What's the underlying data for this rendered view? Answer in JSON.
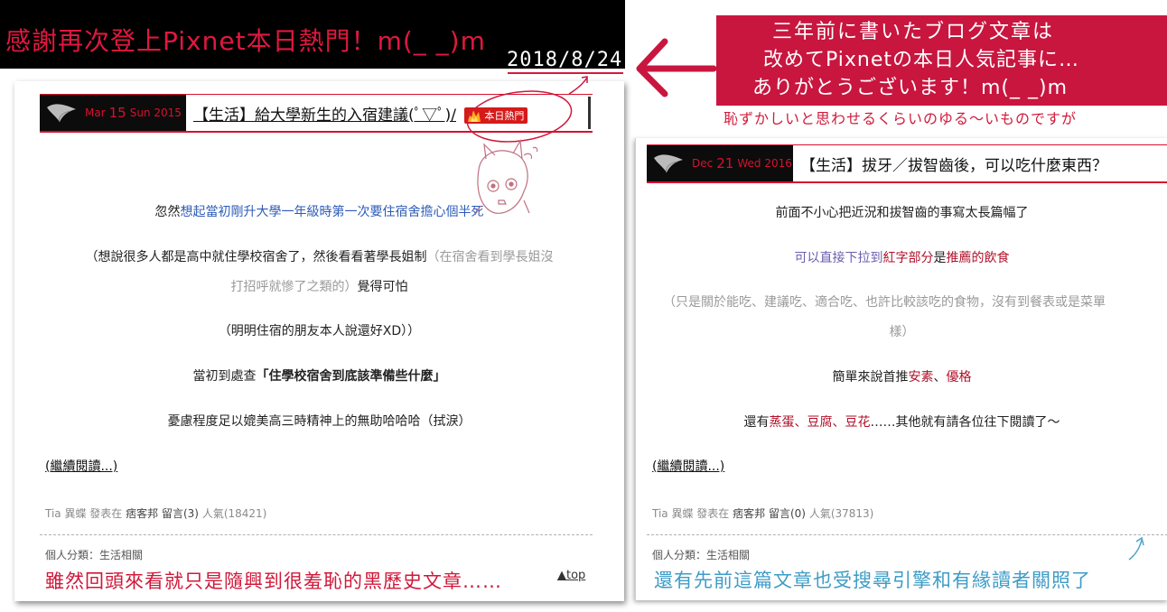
{
  "banner": {
    "title": "感謝再次登上Pixnet本日熱門！m(_ _)m",
    "date": "2018/8/24"
  },
  "note": {
    "line1": "三年前に書いたブログ文章は",
    "line2": "改めてPixnetの本日人気記事に…",
    "line3": "ありがとうございます！m(_ _)m",
    "sub": "恥ずかしいと思わせるくらいのゆる～いものですが"
  },
  "left_post": {
    "date_month": "Mar",
    "date_day": "15",
    "date_weekday": "Sun",
    "date_year": "2015",
    "title": "【生活】給大學新生的入宿建議(ﾟ▽ﾟ)/",
    "hot_badge": "本日熱門",
    "p1_plain": "忽然",
    "p1_blue": "想起當初剛升大學一年級時第一次要住宿舍擔心個半死",
    "p2_line1_plain": "（想說很多人都是高中就住學校宿舍了，然後看看著學長姐制",
    "p2_line1_grey": "（在宿舍看到學長姐沒",
    "p2_line2_grey": "打招呼就慘了之類的）",
    "p2_line2_plain": "覺得可怕",
    "p3": "（明明住宿的朋友本人說還好XD））",
    "p4_plain": "當初到處查",
    "p4_bold": "「住學校宿舍到底該準備些什麼」",
    "p5": "憂慮程度足以媲美高三時精神上的無助哈哈哈（拭淚）",
    "read_more": "(繼續閱讀...)",
    "meta_author": "Tia 異蝶",
    "meta_posted": "發表在",
    "meta_site": "痞客邦",
    "meta_comments": "留言(3)",
    "meta_views": "人氣(18421)",
    "category": "個人分類：生活相關",
    "hand_note": "雖然回頭來看就只是隨興到很羞恥的黑歷史文章……",
    "to_top": "▲top"
  },
  "right_post": {
    "date_month": "Dec",
    "date_day": "21",
    "date_weekday": "Wed",
    "date_year": "2016",
    "title": "【生活】拔牙／拔智齒後，可以吃什麼東西？",
    "p1": "前面不小心把近況和拔智齒的事寫太長篇幅了",
    "p2_purple": "可以直接下拉到",
    "p2_red": "紅字部分",
    "p2_plain": "是",
    "p2_red2": "推薦的飲食",
    "p3_line1": "（只是關於能吃、建議吃、適合吃、也許比較該吃的食物，沒有到餐表或是菜單",
    "p3_line2": "樣）",
    "p4_plain": "簡單來說首推",
    "p4_red1": "安素",
    "p4_sep": "、",
    "p4_red2": "優格",
    "p5_plain1": "還有",
    "p5_red1": "蒸蛋",
    "p5_sep1": "、",
    "p5_red2": "豆腐",
    "p5_sep2": "、",
    "p5_red3": "豆花",
    "p5_plain2": "……其他就有請各位往下閱讀了～",
    "read_more": "(繼續閱讀...)",
    "meta_author": "Tia 異蝶",
    "meta_posted": "發表在",
    "meta_site": "痞客邦",
    "meta_comments": "留言(0)",
    "meta_views": "人氣(37813)",
    "category": "個人分類：生活相關",
    "hand_note": "還有先前這篇文章也受搜尋引擎和有緣讀者關照了"
  },
  "colors": {
    "accent_red": "#c8163f",
    "banner_black": "#000000",
    "note_teal": "#4aa3c8"
  }
}
